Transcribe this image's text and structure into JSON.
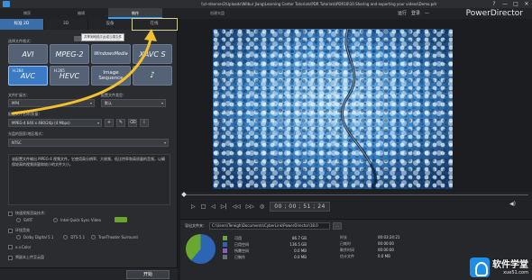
{
  "window": {
    "path": "\\\\cl-rdserver2\\Uploads\\Wilbur Jiang\\Learning Center Tutorials\\PDR Tutorials\\PDR18\\10.Sharing and exporting your videos\\Demo.pdr",
    "controls": [
      "?",
      "—",
      "□",
      "✕"
    ]
  },
  "modebar": {
    "tabs": [
      "捕获",
      "编辑",
      "制作"
    ],
    "active_tab": "制作",
    "sub_label": "创建光盘",
    "hints": [
      "运行",
      "登录",
      "—"
    ],
    "brand": "PowerDirector"
  },
  "left": {
    "tabs": [
      "标准 2D",
      "3D",
      "设备",
      "在线"
    ],
    "tooltip": "共享到网络平台或云端文件",
    "select_format_label": "选择文件格式：",
    "profile_label": "配置文件分析器",
    "formats": [
      {
        "label": "AVI",
        "small": ""
      },
      {
        "label": "MPEG-2",
        "small": ""
      },
      {
        "label": "WindowsMedia",
        "small": ""
      },
      {
        "label": "XAVC S",
        "small": ""
      },
      {
        "label": "AVC",
        "small": "H.264"
      },
      {
        "label": "HEVC",
        "small": "H.265"
      },
      {
        "label": "Image Sequence",
        "small": ""
      },
      {
        "label": "♪",
        "small": ""
      }
    ],
    "container_label": "文件扩展名：",
    "container_value": "MP4",
    "profile_type_label": "配置文件类型：",
    "profile_type_value": "默认",
    "quality_label": "配置文件名称/质量：",
    "quality_value": "MPEG-4 640 x 480/24p (4 Mbps)",
    "standard_label": "光盘的国家/地区格式：",
    "standard_value": "NTSC",
    "description": "该配置文件输出 MPEG-4 视频文件。它使用高分辨率、大帧频、低比特率和高质量的音频，以确保较高的视频质量和较小的文件大小。",
    "hw_accel_label": "快速视频渲染技术：",
    "svrt_label": "SVRT",
    "qsv_label": "Intel Quick Sync Video",
    "surround_label": "环绕音效",
    "dolby_label": "Dolby Digital 5.1",
    "dts_label": "DTS 5.1",
    "truetheater_label": "TrueTheater Surround",
    "xvcolor_label": "x.v.Color",
    "upload_label": "将副本上传至云盘",
    "start_button": "开始"
  },
  "player": {
    "timecode": "00 ; 00 ; 51 ; 24"
  },
  "output": {
    "folder_label": "导出文件夹：",
    "path": "C:\\Users\\Tereigh\\Documents\\CyberLink\\PowerDirector\\18.0",
    "browse": "...",
    "disk": [
      {
        "name": "可用",
        "value": "86.7 GB",
        "color": "#69a82f"
      },
      {
        "name": "已用空间",
        "value": "136.5 GB",
        "color": "#2d65b6"
      },
      {
        "name": "所需空间",
        "value": "0.0 MB",
        "color": "#8a5ad0"
      },
      {
        "name": "已制作",
        "value": "0.0 MB",
        "color": "#6b6f75"
      }
    ],
    "times": [
      {
        "name": "时长",
        "value": "00:03:24:21"
      },
      {
        "name": "已耗时",
        "value": "00:00:00"
      },
      {
        "name": "剩余时间",
        "value": "00:00:00"
      },
      {
        "name": "估计文件",
        "value": "0.0 MB"
      }
    ]
  },
  "watermark": {
    "text": "软件学堂",
    "url": "xue51.com"
  }
}
